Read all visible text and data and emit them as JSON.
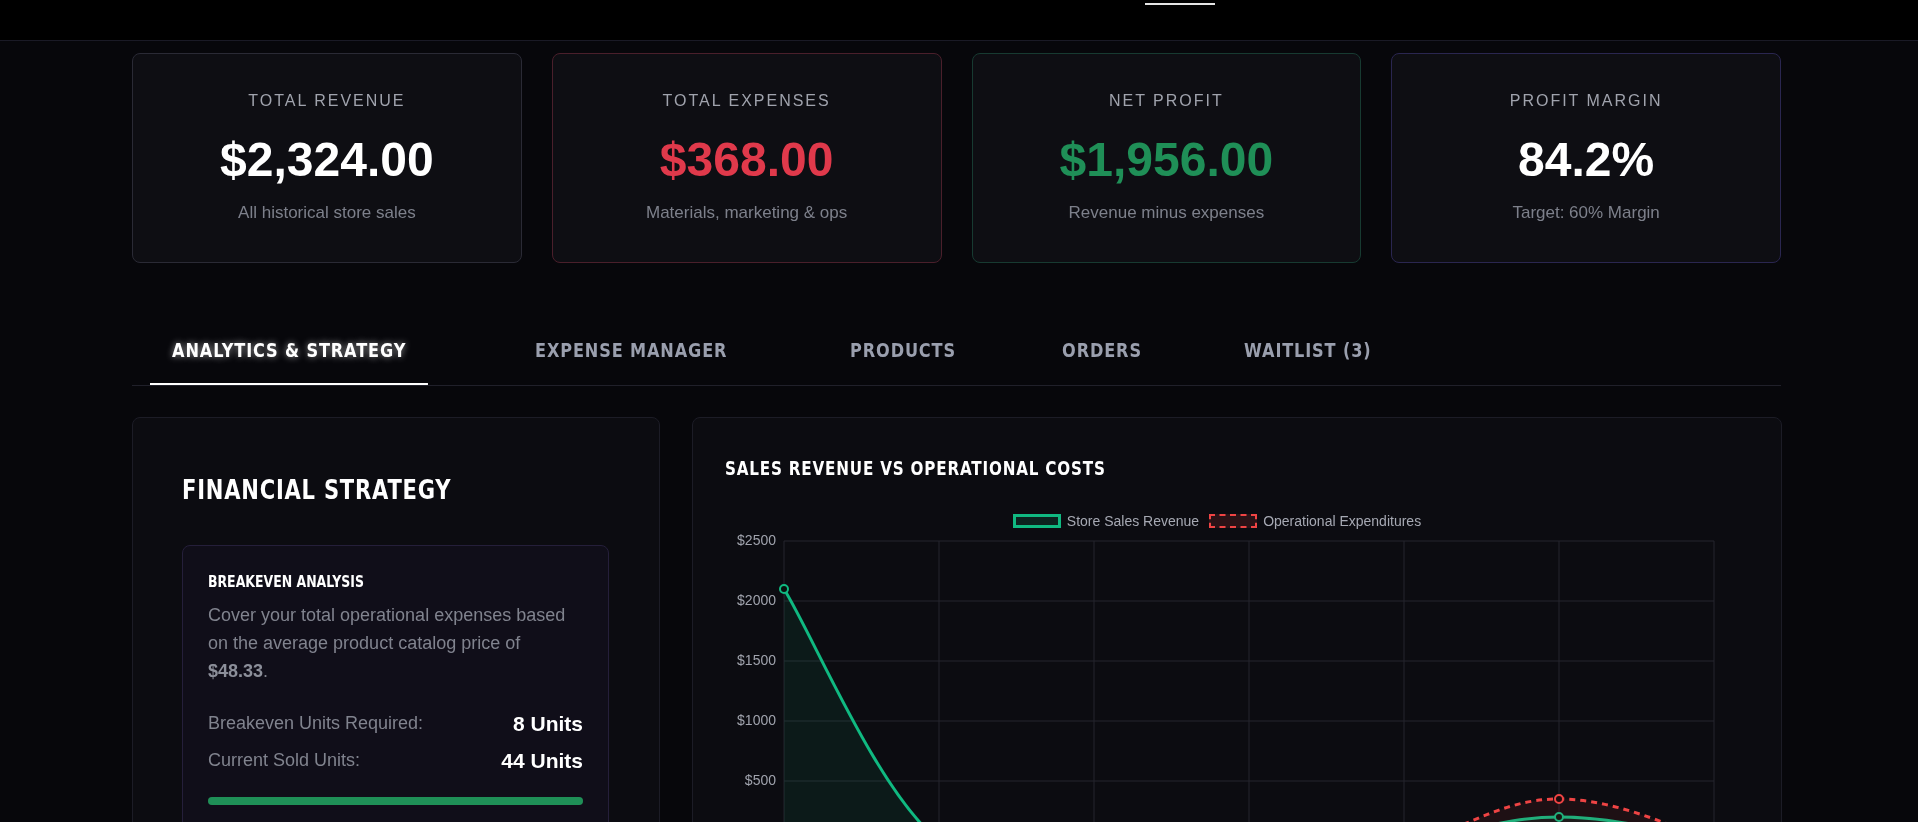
{
  "stats": [
    {
      "label": "TOTAL REVENUE",
      "value": "$2,324.00",
      "note": "All historical store sales",
      "kind": "neutral",
      "color": "#2a2a35"
    },
    {
      "label": "TOTAL EXPENSES",
      "value": "$368.00",
      "note": "Materials, marketing & ops",
      "kind": "negative",
      "color": "#4a1f2b"
    },
    {
      "label": "NET PROFIT",
      "value": "$1,956.00",
      "note": "Revenue minus expenses",
      "kind": "positive",
      "color": "#173a31"
    },
    {
      "label": "PROFIT MARGIN",
      "value": "84.2%",
      "note": "Target: 60% Margin",
      "kind": "neutral",
      "color": "#2a2650"
    }
  ],
  "tabs": [
    {
      "label": "ANALYTICS & STRATEGY",
      "selected": true
    },
    {
      "label": "EXPENSE MANAGER",
      "selected": false
    },
    {
      "label": "PRODUCTS",
      "selected": false
    },
    {
      "label": "ORDERS",
      "selected": false
    },
    {
      "label": "WAITLIST (3)",
      "selected": false
    }
  ],
  "strategy": {
    "title": "FINANCIAL STRATEGY",
    "breakeven": {
      "title": "BREAKEVEN ANALYSIS",
      "text": "Cover your total operational expenses based on the average product catalog price of **$48.33**.",
      "rows": [
        {
          "label": "Breakeven Units Required:",
          "value": "8 Units"
        },
        {
          "label": "Current Sold Units:",
          "value": "44 Units"
        }
      ],
      "level": 1
    }
  },
  "chart": {
    "title": "SALES REVENUE VS OPERATIONAL COSTS",
    "chart_data": {
      "type": "area",
      "grid": true,
      "legend": true,
      "series": [
        {
          "name": "Store Sales Revenue",
          "color": "#10b981",
          "marker": "circle",
          "values": [
            2100,
            0,
            0,
            0,
            0,
            200,
            0
          ]
        },
        {
          "name": "Operational Expenditures",
          "color": "#ef4444",
          "marker": "circle",
          "values": [
            0,
            0,
            0,
            0,
            0,
            350,
            0
          ]
        }
      ],
      "ylim": [
        0,
        2500
      ],
      "yticks": [
        {
          "value": 500,
          "label": "$500"
        },
        {
          "value": 1000,
          "label": "$1000"
        },
        {
          "value": 1500,
          "label": "$1500"
        },
        {
          "value": 2000,
          "label": "$2000"
        },
        {
          "value": 2500,
          "label": "$2500"
        }
      ]
    }
  }
}
